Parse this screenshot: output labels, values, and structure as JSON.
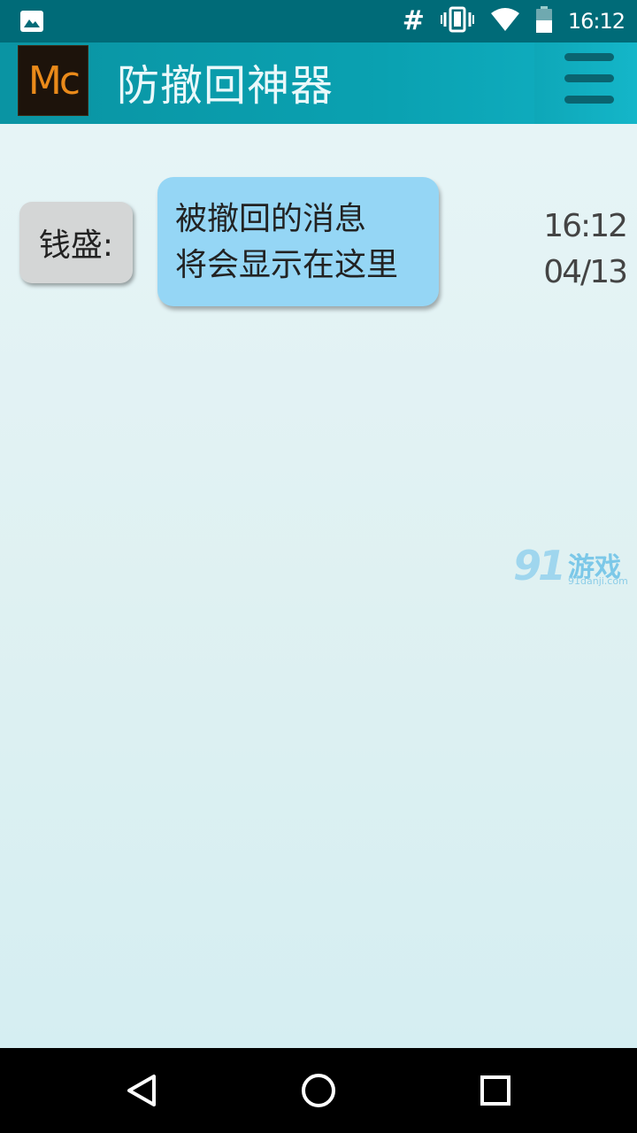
{
  "status_bar": {
    "hash": "#",
    "time": "16:12"
  },
  "header": {
    "logo_text": "Mc",
    "title": "防撤回神器"
  },
  "message": {
    "sender": "钱盛:",
    "lines": [
      "被撤回的消息",
      "将会显示在这里"
    ],
    "time": "16:12",
    "date": "04/13"
  },
  "watermark": {
    "number": "91",
    "text": "游戏",
    "url": "91danji.com"
  },
  "colors": {
    "status_bar": "#006b78",
    "header": "#0aa1b1",
    "bubble": "#95d6f5",
    "sender_box": "#d4d6d6",
    "background": "#dff1f2"
  }
}
